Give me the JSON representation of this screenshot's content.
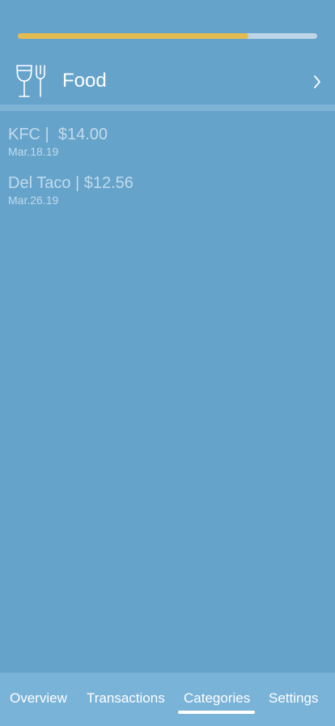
{
  "budget": {
    "progress_fraction": 0.77,
    "fill_color": "#e3bb50",
    "track_color": "#bcd6e8"
  },
  "category": {
    "name": "Food",
    "icon": "wine-glass-fork-icon",
    "chevron_icon": "chevron-right-icon"
  },
  "transactions": [
    {
      "main": "KFC |  $14.00",
      "date": "Mar.18.19"
    },
    {
      "main": "Del Taco | $12.56",
      "date": "Mar.26.19"
    }
  ],
  "tabs": [
    {
      "label": "Overview",
      "active": false
    },
    {
      "label": "Transactions",
      "active": false
    },
    {
      "label": "Categories",
      "active": true
    },
    {
      "label": "Settings",
      "active": false
    }
  ],
  "colors": {
    "background": "#65a3cb",
    "tabbar": "#7ab3d8",
    "muted_text": "#c2dbeb"
  }
}
